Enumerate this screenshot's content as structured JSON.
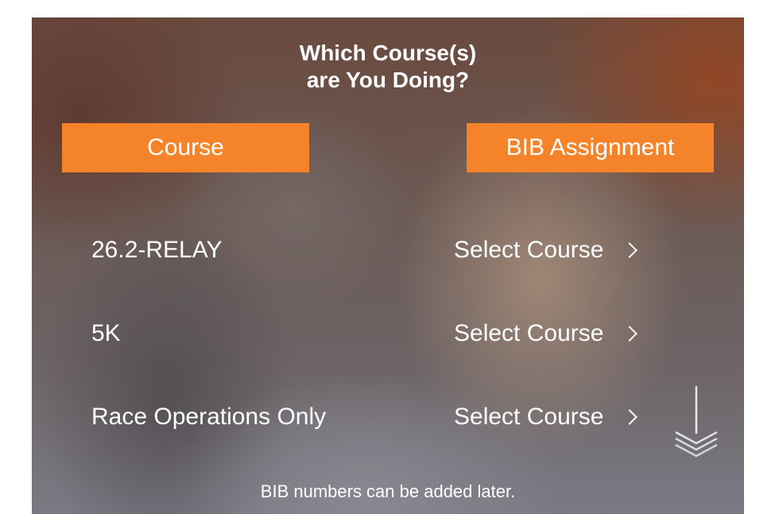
{
  "title": {
    "line1": "Which Course(s)",
    "line2": "are You Doing?"
  },
  "headers": {
    "course": "Course",
    "bib_assignment": "BIB Assignment"
  },
  "courses": [
    {
      "name": "26.2-RELAY",
      "action": "Select Course"
    },
    {
      "name": "5K",
      "action": "Select Course"
    },
    {
      "name": "Race Operations Only",
      "action": "Select Course"
    }
  ],
  "footer_note": "BIB numbers can be added later.",
  "icons": {
    "row_chevron": "chevron-right-icon",
    "scroll_hint": "scroll-down-icon"
  },
  "colors": {
    "accent": "#f5832a",
    "text": "#ffffff"
  }
}
